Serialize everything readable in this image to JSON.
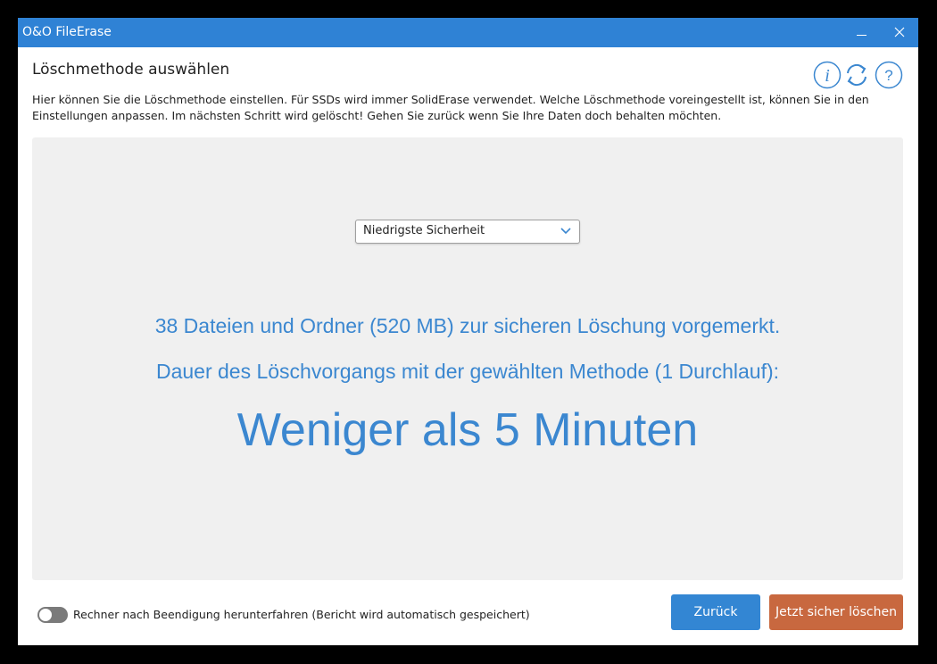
{
  "window": {
    "title": "O&O FileErase"
  },
  "header": {
    "heading": "Löschmethode auswählen",
    "description": "Hier können Sie die Löschmethode einstellen. Für SSDs wird immer SolidErase verwendet. Welche Löschmethode voreingestellt ist, können Sie in den Einstellungen anpassen. Im nächsten Schritt wird gelöscht! Gehen Sie zurück wenn Sie Ihre Daten doch behalten möchten."
  },
  "icons": [
    "info-icon",
    "refresh-icon",
    "help-icon"
  ],
  "method_select": {
    "value": "Niedrigste Sicherheit"
  },
  "summary": {
    "files_line": "38 Dateien und Ordner (520 MB) zur sicheren Löschung vorgemerkt.",
    "duration_line": "Dauer des Löschvorgangs mit der gewählten Methode (1 Durchlauf):",
    "duration_value": "Weniger als 5 Minuten"
  },
  "shutdown_toggle": {
    "label": "Rechner nach Beendigung herunterfahren (Bericht wird automatisch gespeichert)",
    "enabled": false
  },
  "buttons": {
    "back": "Zurück",
    "erase": "Jetzt sicher löschen"
  },
  "colors": {
    "titlebar": "#2f82d5",
    "accent_text": "#3b87d0",
    "back_button": "#3386d3",
    "erase_button": "#c8683f"
  }
}
